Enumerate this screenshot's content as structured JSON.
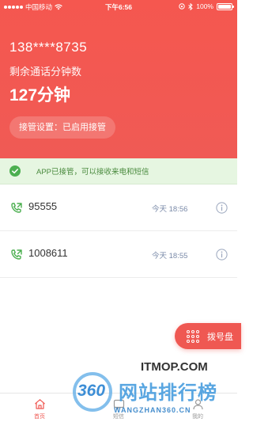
{
  "status_bar": {
    "carrier": "中国移动",
    "time": "下午6:56",
    "battery": "100%",
    "battery_level": 1.0
  },
  "account": {
    "phone": "138****8735",
    "remaining_label": "剩余通话分钟数",
    "remaining_value": "127分钟",
    "takeover_setting": "接管设置：已启用接管"
  },
  "notice": {
    "text": "APP已接管，可以接收来电和短信",
    "icon": "check-circle-icon"
  },
  "calls": [
    {
      "number": "95555",
      "time": "今天 18:56",
      "icon": "incoming-call-icon"
    },
    {
      "number": "1008611",
      "time": "今天 18:55",
      "icon": "incoming-call-icon"
    }
  ],
  "dial_pad_button": {
    "label": "拨号盘",
    "icon": "keypad-icon"
  },
  "tabs": [
    {
      "label": "首页",
      "icon": "home-icon",
      "active": true
    },
    {
      "label": "短信",
      "icon": "message-icon",
      "active": false
    },
    {
      "label": "我的",
      "icon": "user-icon",
      "active": false
    }
  ],
  "watermark": {
    "badge": "360",
    "title": "网站排行榜",
    "url": "WANGZHAN360.CN",
    "brand": "ITMOP.COM"
  },
  "colors": {
    "accent": "#ef5852",
    "notice_bg": "#e6f6e1",
    "notice_text": "#4a8a3e",
    "call_icon": "#4caf50"
  }
}
